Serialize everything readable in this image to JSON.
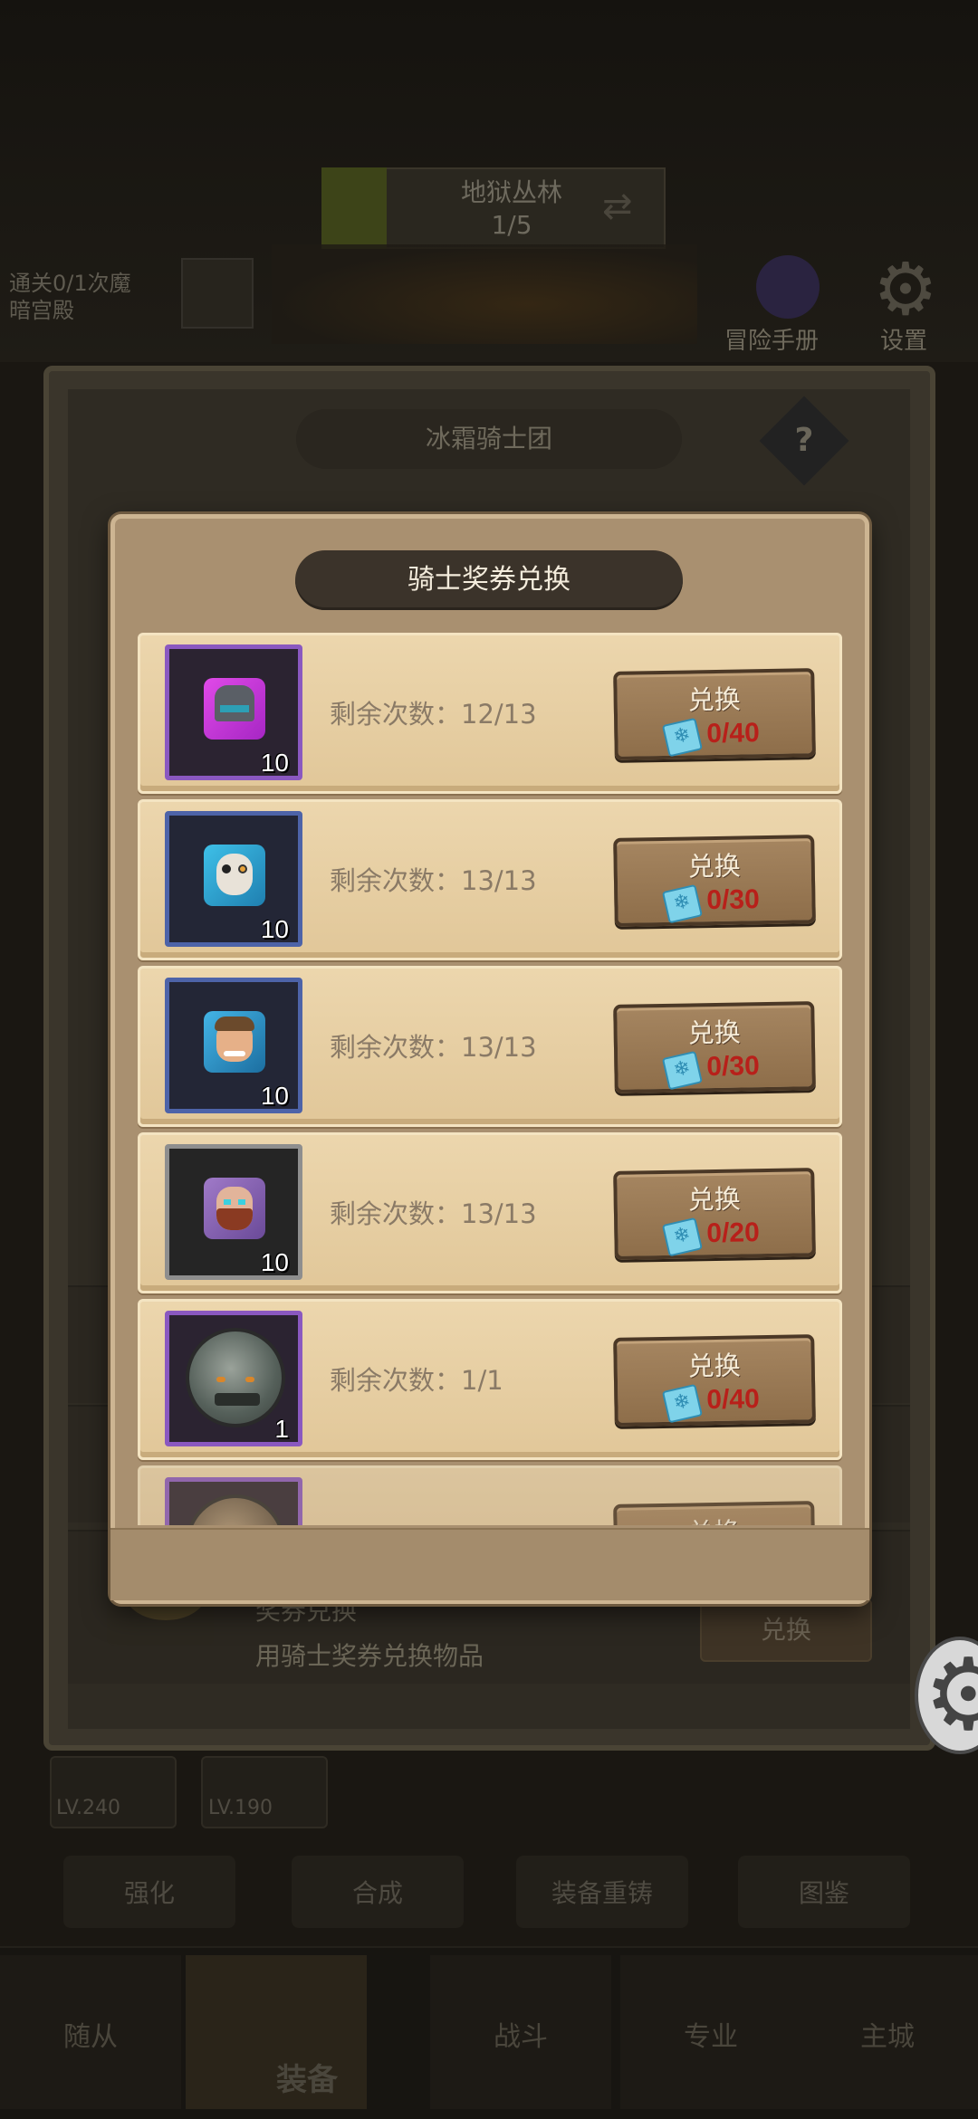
{
  "background": {
    "level": {
      "name": "地狱丛林",
      "progress": "1/5"
    },
    "left_note": [
      "通关0/1次魔",
      "暗宫殿"
    ],
    "guide_label": "冒险手册",
    "settings_label": "设置",
    "panel_title": "冰霜骑士团",
    "underlay_row": {
      "title": "奖券兑换",
      "desc": "用骑士奖券兑换物品",
      "button": "兑换"
    },
    "slots": [
      "LV.240",
      "LV.190"
    ],
    "nav_tabs": [
      "强化",
      "合成",
      "装备重铸",
      "图鉴"
    ],
    "bottom_tabs": [
      "随从",
      "装备",
      "战斗",
      "专业",
      "主城"
    ]
  },
  "modal": {
    "title": "骑士奖券兑换",
    "items": [
      {
        "frame": "purple",
        "quantity": "10",
        "remaining": "剩余次数：12/13",
        "button": "兑换",
        "cost": "0/40"
      },
      {
        "frame": "blue",
        "quantity": "10",
        "remaining": "剩余次数：13/13",
        "button": "兑换",
        "cost": "0/30"
      },
      {
        "frame": "blue",
        "quantity": "10",
        "remaining": "剩余次数：13/13",
        "button": "兑换",
        "cost": "0/30"
      },
      {
        "frame": "gray",
        "quantity": "10",
        "remaining": "剩余次数：13/13",
        "button": "兑换",
        "cost": "0/20"
      },
      {
        "frame": "purple",
        "quantity": "1",
        "remaining": "剩余次数：1/1",
        "button": "兑换",
        "cost": "0/40"
      },
      {
        "frame": "purple",
        "quantity": "",
        "remaining": "",
        "button": "兑换",
        "cost": ""
      }
    ]
  },
  "colors": {
    "cost_red": "#b8201a",
    "ticket_blue": "#7fd3ea",
    "modal_bg": "#a99070"
  },
  "icons": {
    "ticket": "ticket-icon",
    "help": "question-icon",
    "settings": "gear-icon"
  }
}
